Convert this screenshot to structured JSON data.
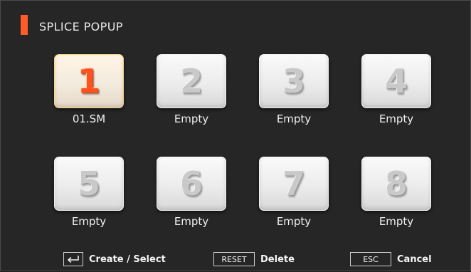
{
  "window": {
    "title": "SPLICE POPUP",
    "accent_color": "#ff5a2a"
  },
  "slots": [
    {
      "number": "1",
      "label": "01.SM",
      "selected": true
    },
    {
      "number": "2",
      "label": "Empty"
    },
    {
      "number": "3",
      "label": "Empty"
    },
    {
      "number": "4",
      "label": "Empty"
    },
    {
      "number": "5",
      "label": "Empty"
    },
    {
      "number": "6",
      "label": "Empty"
    },
    {
      "number": "7",
      "label": "Empty"
    },
    {
      "number": "8",
      "label": "Empty"
    }
  ],
  "footer": {
    "enter": {
      "icon": "enter-arrow-icon",
      "label": "Create / Select"
    },
    "reset": {
      "key": "RESET",
      "label": "Delete"
    },
    "esc": {
      "key": "ESC",
      "label": "Cancel"
    }
  }
}
